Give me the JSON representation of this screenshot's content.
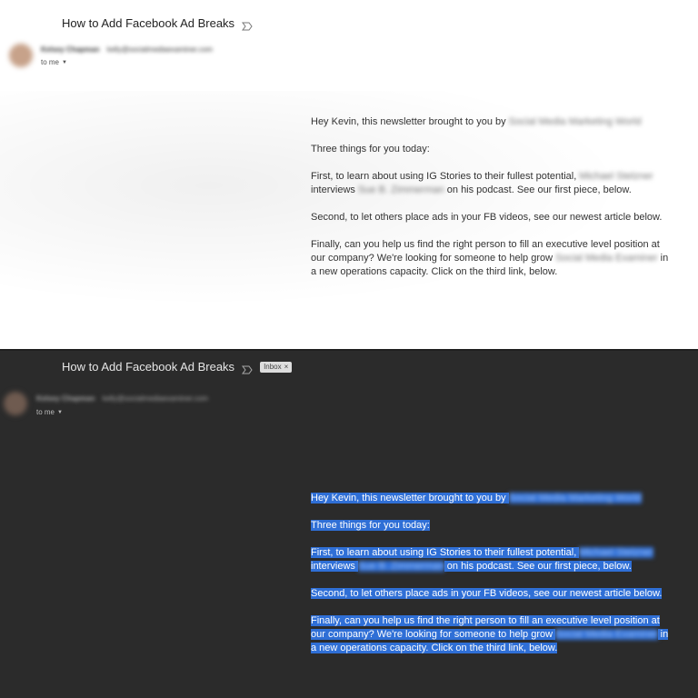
{
  "light": {
    "subject": "How to Add Facebook Ad Breaks",
    "sender_name": "Kelsey Chapman",
    "sender_email": "kelly@socialmediaexaminer.com",
    "recipient": "to me",
    "body": {
      "p1_prefix": "Hey Kevin, this newsletter brought to you by ",
      "p1_blurred": "Social Media Marketing World",
      "p2": "Three things for you today:",
      "p3_prefix": "First, to learn about using IG Stories to their fullest potential, ",
      "p3_blurred_a": "Michael Stelzner",
      "p3_mid": "interviews ",
      "p3_blurred_b": "Sue B. Zimmerman",
      "p3_suffix": " on his podcast. See our first piece, below.",
      "p4": "Second, to let others place ads in your FB videos, see our newest article below.",
      "p5_prefix": "Finally, can you help us find the right person to fill an executive level position at our company? We're looking for someone to help grow ",
      "p5_blurred": "Social Media Examiner",
      "p5_suffix": " in a new operations capacity. Click on the third link, below."
    }
  },
  "dark": {
    "subject": "How to Add Facebook Ad Breaks",
    "label_chip": "Inbox",
    "label_close": "×",
    "sender_name": "Kelsey Chapman",
    "sender_email": "kelly@socialmediaexaminer.com",
    "recipient": "to me",
    "body": {
      "p1_prefix": "Hey Kevin, this newsletter brought to you by ",
      "p1_blurred": "Social Media Marketing World",
      "p2": "Three things for you today:",
      "p3_prefix": "First, to learn about using IG Stories to their fullest potential, ",
      "p3_blurred_a": "Michael Stelzner",
      "p3_mid": "interviews ",
      "p3_blurred_b": "Sue B. Zimmerman",
      "p3_suffix": " on his podcast. See our first piece, below.",
      "p4": "Second, to let others place ads in your FB videos, see our newest article below.",
      "p5_prefix": "Finally, can you help us find the right person to fill an executive level position at our company? We're looking for someone to help grow ",
      "p5_blurred": "Social Media Examiner",
      "p5_suffix": " in a new operations capacity. Click on the third link, below."
    }
  },
  "icons": {
    "important": "important-marker-icon",
    "caret": "chevron-down-icon"
  },
  "colors": {
    "selection": "#2f6fd6",
    "dark_bg": "#2b2b2b",
    "light_bg": "#ffffff"
  }
}
